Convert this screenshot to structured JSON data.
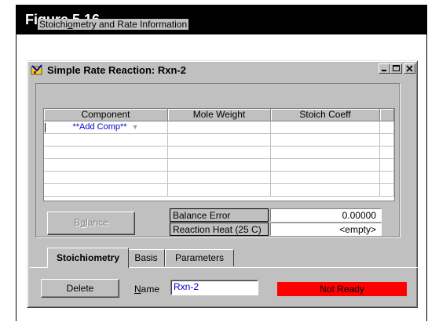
{
  "figure": {
    "title": "Figure 5.16"
  },
  "window": {
    "title": "Simple Rate Reaction: Rxn-2",
    "controls": {
      "minimize": "_",
      "maximize": "□",
      "close": "×"
    }
  },
  "group": {
    "label_prefix": "Stoichi",
    "label_mnemonic": "o",
    "label_suffix": "metry and Rate Information"
  },
  "grid": {
    "columns": [
      "Component",
      "Mole Weight",
      "Stoich Coeff",
      ""
    ],
    "rows": [
      [
        "**Add Comp**",
        "",
        "",
        ""
      ],
      [
        "",
        "",
        "",
        ""
      ],
      [
        "",
        "",
        "",
        ""
      ],
      [
        "",
        "",
        "",
        ""
      ],
      [
        "",
        "",
        "",
        ""
      ],
      [
        "",
        "",
        "",
        ""
      ]
    ]
  },
  "balance_button": {
    "label_prefix": "B",
    "label_mnemonic": "a",
    "label_suffix": "lance"
  },
  "info": {
    "balance_error_label": "Balance Error",
    "balance_error_value": "0.00000",
    "reaction_heat_label": "Reaction Heat (25 C)",
    "reaction_heat_value": "<empty>"
  },
  "tabs": [
    {
      "label": "Stoichiometry",
      "active": true
    },
    {
      "label": "Basis",
      "active": false
    },
    {
      "label": "Parameters",
      "active": false
    }
  ],
  "footer": {
    "delete_label": "Delete",
    "name_label_mnemonic": "N",
    "name_label_suffix": "ame",
    "name_value": "Rxn-2",
    "status_text": "Not Ready",
    "status_color": "#ff0000"
  },
  "colors": {
    "window_face": "#c0c0c0",
    "link_text": "#0000c8"
  }
}
